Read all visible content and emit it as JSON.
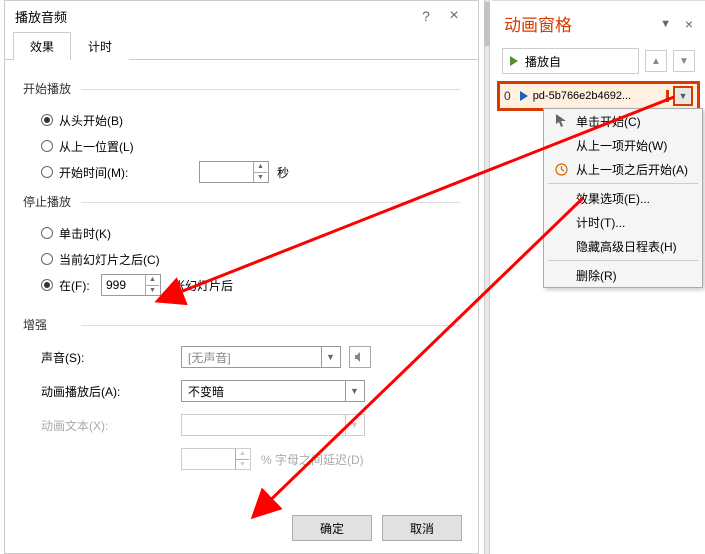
{
  "dialog": {
    "title": "播放音频",
    "tabs": {
      "effect": "效果",
      "timing": "计时"
    },
    "playStart": {
      "group": "开始播放",
      "fromBeginning": "从头开始(B)",
      "fromLastPos": "从上一位置(L)",
      "startTimeLabel": "开始时间(M):",
      "startTimeValue": "",
      "startTimeUnit": "秒"
    },
    "playStop": {
      "group": "停止播放",
      "onClick": "单击时(K)",
      "afterCurrent": "当前幻灯片之后(C)",
      "atLabel": "在(F):",
      "atValue": "999",
      "atUnit": "张幻灯片后"
    },
    "enhance": {
      "group": "增强",
      "soundLabel": "声音(S):",
      "soundValue": "[无声音]",
      "afterLabel": "动画播放后(A):",
      "afterValue": "不变暗",
      "textLabel": "动画文本(X):",
      "textValue": "",
      "delayLabel": "% 字母之间延迟(D)",
      "delayValue": ""
    },
    "ok": "确定",
    "cancel": "取消"
  },
  "panel": {
    "title": "动画窗格",
    "playFrom": "播放自",
    "item": {
      "index": "0",
      "label": "pd-5b766e2b4692..."
    }
  },
  "menu": {
    "clickStart": "单击开始(C)",
    "withPrev": "从上一项开始(W)",
    "afterPrev": "从上一项之后开始(A)",
    "effectOptions": "效果选项(E)...",
    "timing": "计时(T)...",
    "hideTimeline": "隐藏高级日程表(H)",
    "remove": "删除(R)"
  }
}
